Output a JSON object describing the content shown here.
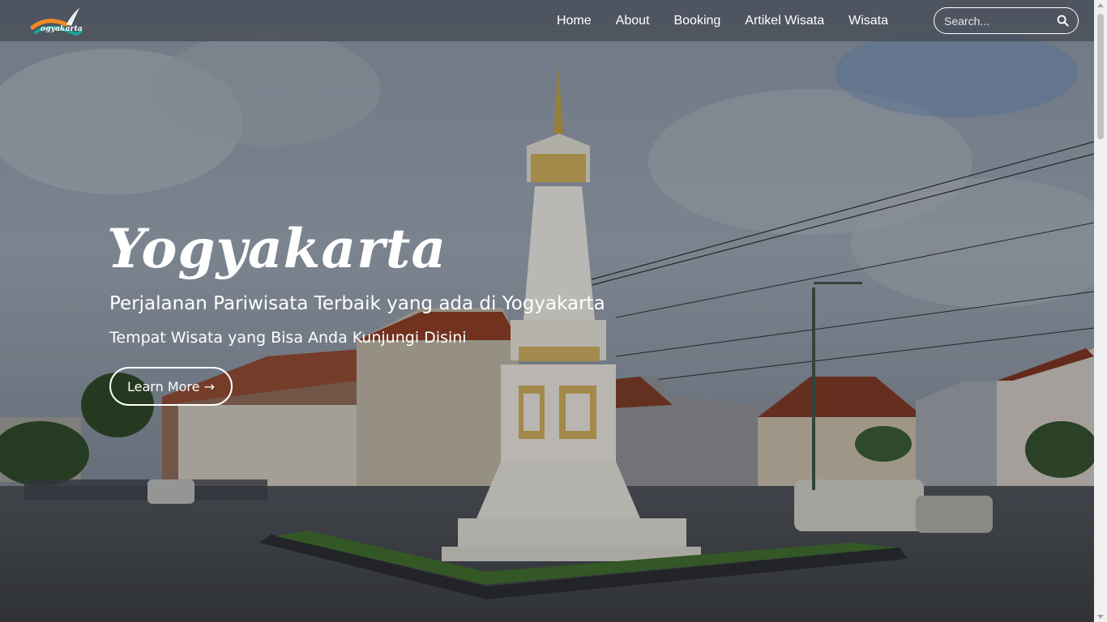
{
  "brand": {
    "logo_text": "ogyakarta",
    "colors": {
      "orange": "#f08a24",
      "teal": "#1ea39a",
      "white": "#ffffff"
    }
  },
  "nav": {
    "items": [
      {
        "label": "Home"
      },
      {
        "label": "About"
      },
      {
        "label": "Booking"
      },
      {
        "label": "Artikel Wisata"
      },
      {
        "label": "Wisata"
      }
    ]
  },
  "search": {
    "placeholder": "Search...",
    "icon": "search-icon"
  },
  "hero": {
    "title": "Yogyakarta",
    "subtitle": "Perjalanan Pariwisata Terbaik yang ada di Yogyakarta",
    "tagline": "Tempat Wisata yang Bisa Anda Kunjungi Disini",
    "button_label": "Learn More →",
    "background": "tugu-monument-photo"
  }
}
